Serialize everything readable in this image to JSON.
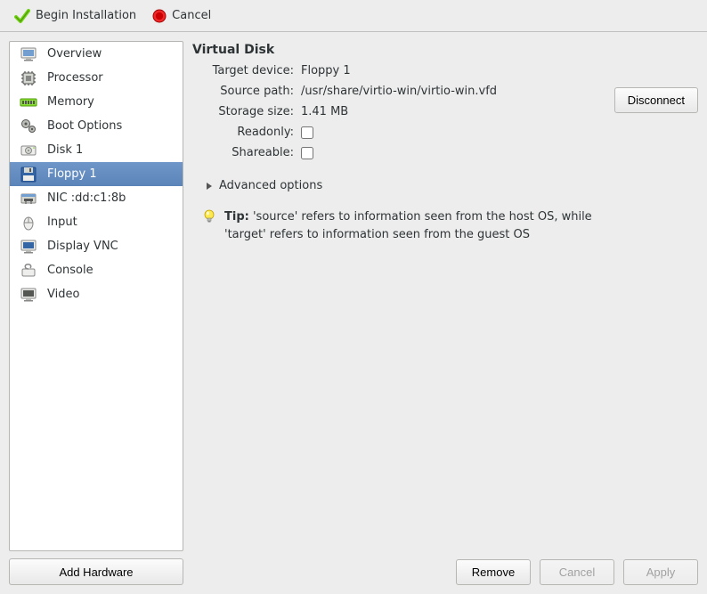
{
  "toolbar": {
    "begin_label": "Begin Installation",
    "cancel_label": "Cancel"
  },
  "sidebar": {
    "items": [
      {
        "label": "Overview",
        "icon": "monitor"
      },
      {
        "label": "Processor",
        "icon": "cpu"
      },
      {
        "label": "Memory",
        "icon": "ram"
      },
      {
        "label": "Boot Options",
        "icon": "gears"
      },
      {
        "label": "Disk 1",
        "icon": "disk"
      },
      {
        "label": "Floppy 1",
        "icon": "floppy",
        "selected": true
      },
      {
        "label": "NIC :dd:c1:8b",
        "icon": "nic"
      },
      {
        "label": "Input",
        "icon": "mouse"
      },
      {
        "label": "Display VNC",
        "icon": "display"
      },
      {
        "label": "Console",
        "icon": "console"
      },
      {
        "label": "Video",
        "icon": "video"
      }
    ],
    "add_hardware_label": "Add Hardware"
  },
  "main": {
    "section_title": "Virtual Disk",
    "fields": {
      "target_label": "Target device:",
      "target_value": "Floppy 1",
      "source_label": "Source path:",
      "source_value": "/usr/share/virtio-win/virtio-win.vfd",
      "size_label": "Storage size:",
      "size_value": "1.41 MB",
      "readonly_label": "Readonly:",
      "shareable_label": "Shareable:"
    },
    "disconnect_label": "Disconnect",
    "advanced_label": "Advanced options",
    "tip_bold": "Tip:",
    "tip_text": "'source' refers to information seen from the host OS, while 'target' refers to information seen from the guest OS"
  },
  "footer": {
    "remove_label": "Remove",
    "cancel_label": "Cancel",
    "apply_label": "Apply"
  }
}
